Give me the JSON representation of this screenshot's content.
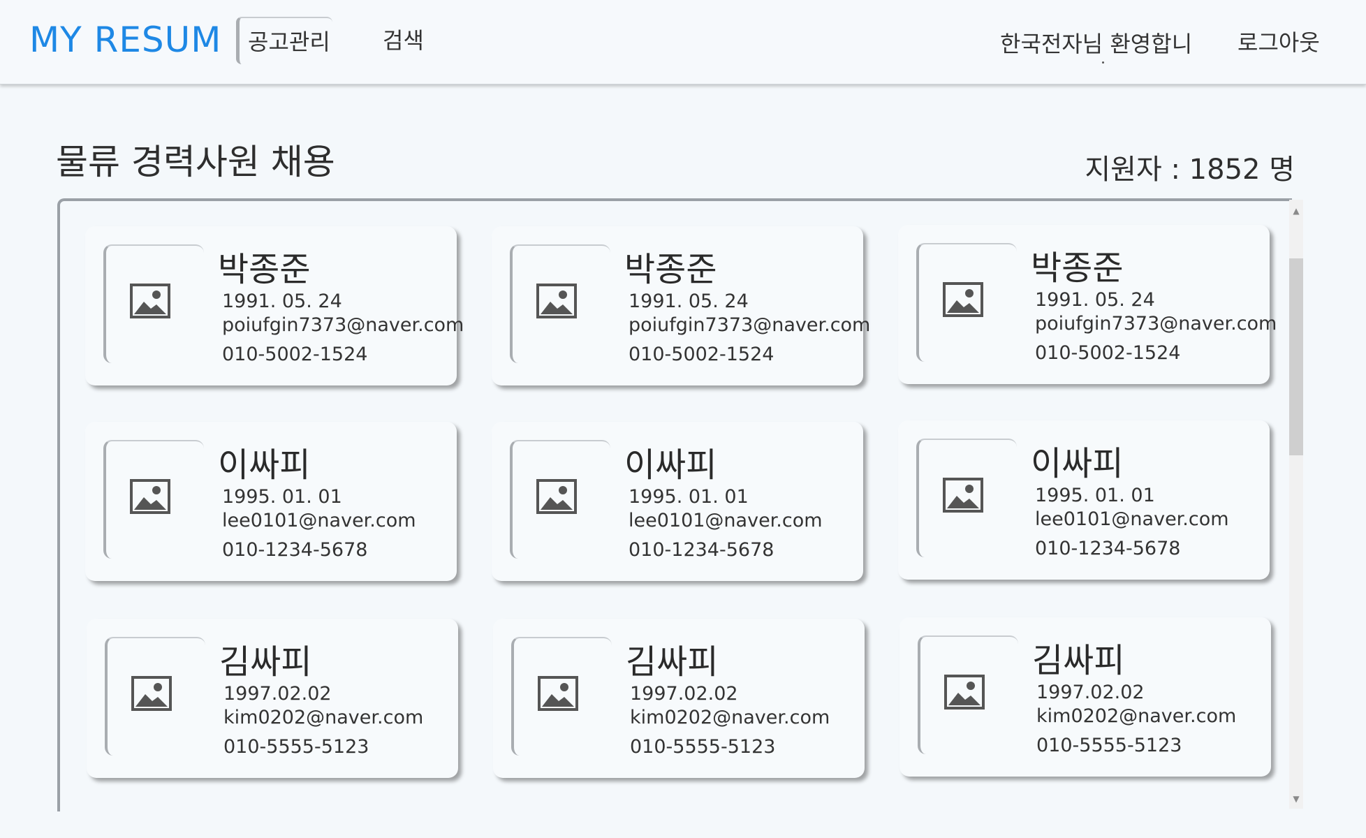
{
  "header": {
    "logo": "MY RESUM",
    "nav": [
      {
        "label": "공고관리"
      },
      {
        "label": "검색"
      }
    ],
    "welcome": "한국전자님 환영합니",
    "logout": "로그아웃"
  },
  "job": {
    "title": "물류 경력사원 채용",
    "applicants": "지원자 : 1852 명"
  },
  "icons": {
    "photo": "image-placeholder-icon",
    "scroll_up": "scroll-up-arrow",
    "scroll_down": "scroll-down-arrow"
  },
  "colors": {
    "brand": "#1e88e5",
    "background": "#f4f8fb",
    "card": "#f7fafc"
  },
  "applicants": [
    {
      "name": "박종준",
      "birth": "1991. 05. 24",
      "email": "poiufgin7373@naver.com",
      "phone": "010-5002-1524"
    },
    {
      "name": "박종준",
      "birth": "1991. 05. 24",
      "email": "poiufgin7373@naver.com",
      "phone": "010-5002-1524"
    },
    {
      "name": "박종준",
      "birth": "1991. 05. 24",
      "email": "poiufgin7373@naver.com",
      "phone": "010-5002-1524"
    },
    {
      "name": "이싸피",
      "birth": "1995. 01. 01",
      "email": "lee0101@naver.com",
      "phone": "010-1234-5678"
    },
    {
      "name": "이싸피",
      "birth": "1995. 01. 01",
      "email": "lee0101@naver.com",
      "phone": "010-1234-5678"
    },
    {
      "name": "이싸피",
      "birth": "1995. 01. 01",
      "email": "lee0101@naver.com",
      "phone": "010-1234-5678"
    },
    {
      "name": "김싸피",
      "birth": "1997.02.02",
      "email": "kim0202@naver.com",
      "phone": "010-5555-5123"
    },
    {
      "name": "김싸피",
      "birth": "1997.02.02",
      "email": "kim0202@naver.com",
      "phone": "010-5555-5123"
    },
    {
      "name": "김싸피",
      "birth": "1997.02.02",
      "email": "kim0202@naver.com",
      "phone": "010-5555-5123"
    }
  ]
}
